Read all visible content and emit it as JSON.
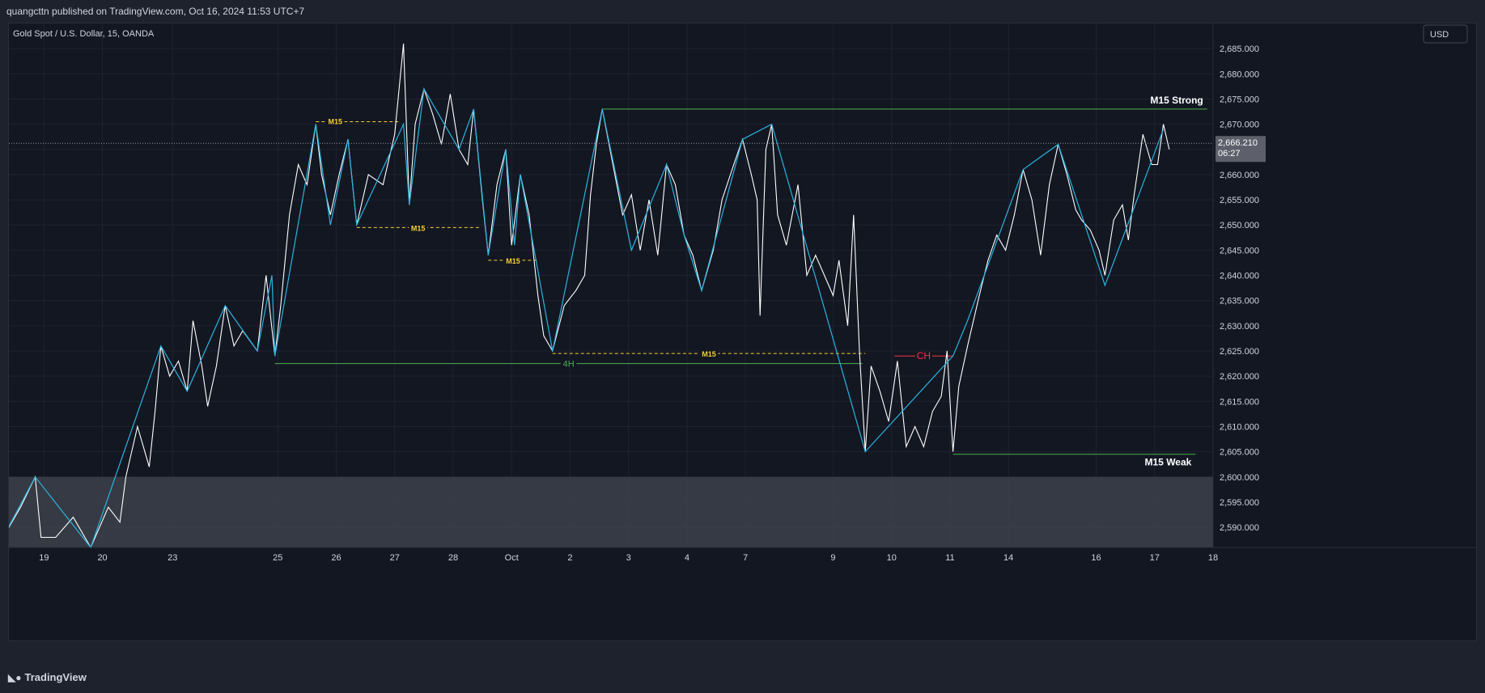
{
  "header": {
    "publisher_line": "quangcttn published on TradingView.com, Oct 16, 2024 11:53 UTC+7"
  },
  "footer": {
    "brand": "TradingView",
    "brand_icon": "tradingview-logo-icon"
  },
  "colors": {
    "background": "#131722",
    "price_line": "#ffffff",
    "zigzag": "#2ab4e0",
    "m15_level": "#f5d033",
    "strong_line": "#4caf50",
    "ch_line": "#f23645",
    "shade": "#40434d",
    "text": "#d1d4dc"
  },
  "chart_data": {
    "type": "line",
    "title": "Gold Spot / U.S. Dollar, 15, OANDA",
    "currency": "USD",
    "current_price": "2,666.210",
    "countdown": "06:27",
    "ylim": [
      2586,
      2690
    ],
    "y_ticks": [
      "2,590.000",
      "2,595.000",
      "2,600.000",
      "2,605.000",
      "2,610.000",
      "2,615.000",
      "2,620.000",
      "2,625.000",
      "2,630.000",
      "2,635.000",
      "2,640.000",
      "2,645.000",
      "2,650.000",
      "2,655.000",
      "2,660.000",
      "2,665.000",
      "2,670.000",
      "2,675.000",
      "2,680.000",
      "2,685.000"
    ],
    "x_ticks": [
      "19",
      "20",
      "23",
      "25",
      "26",
      "27",
      "28",
      "Oct",
      "2",
      "3",
      "4",
      "7",
      "9",
      "10",
      "11",
      "14",
      "16",
      "17",
      "18"
    ],
    "x_tick_index": [
      0.4,
      1.4,
      2.6,
      4.4,
      5.4,
      6.4,
      7.4,
      8.4,
      9.4,
      10.4,
      11.4,
      12.4,
      13.9,
      14.9,
      15.9,
      16.9,
      18.4,
      19.4,
      20.4
    ],
    "xlim": [
      -0.2,
      20.4
    ],
    "price_path": [
      [
        -0.3,
        2588
      ],
      [
        0.0,
        2594
      ],
      [
        0.25,
        2600
      ],
      [
        0.35,
        2588
      ],
      [
        0.6,
        2588
      ],
      [
        0.9,
        2592
      ],
      [
        1.2,
        2586
      ],
      [
        1.5,
        2594
      ],
      [
        1.7,
        2591
      ],
      [
        1.8,
        2600
      ],
      [
        2.0,
        2610
      ],
      [
        2.2,
        2602
      ],
      [
        2.3,
        2613
      ],
      [
        2.4,
        2626
      ],
      [
        2.55,
        2620
      ],
      [
        2.7,
        2623
      ],
      [
        2.85,
        2617
      ],
      [
        2.95,
        2631
      ],
      [
        3.1,
        2622
      ],
      [
        3.2,
        2614
      ],
      [
        3.35,
        2622
      ],
      [
        3.5,
        2634
      ],
      [
        3.65,
        2626
      ],
      [
        3.8,
        2629
      ],
      [
        4.05,
        2625
      ],
      [
        4.2,
        2640
      ],
      [
        4.35,
        2624
      ],
      [
        4.45,
        2634
      ],
      [
        4.6,
        2652
      ],
      [
        4.75,
        2662
      ],
      [
        4.9,
        2658
      ],
      [
        5.05,
        2670
      ],
      [
        5.15,
        2660
      ],
      [
        5.3,
        2652
      ],
      [
        5.45,
        2660
      ],
      [
        5.6,
        2667
      ],
      [
        5.75,
        2650
      ],
      [
        5.95,
        2660
      ],
      [
        6.2,
        2658
      ],
      [
        6.4,
        2668
      ],
      [
        6.55,
        2686
      ],
      [
        6.65,
        2654
      ],
      [
        6.75,
        2670
      ],
      [
        6.9,
        2677
      ],
      [
        7.05,
        2672
      ],
      [
        7.2,
        2666
      ],
      [
        7.35,
        2676
      ],
      [
        7.5,
        2665
      ],
      [
        7.65,
        2662
      ],
      [
        7.75,
        2673
      ],
      [
        7.9,
        2655
      ],
      [
        8.0,
        2644
      ],
      [
        8.15,
        2658
      ],
      [
        8.3,
        2665
      ],
      [
        8.4,
        2646
      ],
      [
        8.55,
        2660
      ],
      [
        8.7,
        2652
      ],
      [
        8.85,
        2636
      ],
      [
        8.95,
        2628
      ],
      [
        9.1,
        2625
      ],
      [
        9.3,
        2634
      ],
      [
        9.5,
        2637
      ],
      [
        9.65,
        2640
      ],
      [
        9.75,
        2656
      ],
      [
        9.85,
        2666
      ],
      [
        9.95,
        2673
      ],
      [
        10.1,
        2664
      ],
      [
        10.3,
        2652
      ],
      [
        10.45,
        2656
      ],
      [
        10.6,
        2645
      ],
      [
        10.75,
        2655
      ],
      [
        10.9,
        2644
      ],
      [
        11.05,
        2662
      ],
      [
        11.2,
        2658
      ],
      [
        11.35,
        2648
      ],
      [
        11.5,
        2644
      ],
      [
        11.65,
        2637
      ],
      [
        11.85,
        2645
      ],
      [
        12.0,
        2655
      ],
      [
        12.2,
        2662
      ],
      [
        12.35,
        2667
      ],
      [
        12.5,
        2660
      ],
      [
        12.6,
        2655
      ],
      [
        12.65,
        2632
      ],
      [
        12.75,
        2665
      ],
      [
        12.85,
        2670
      ],
      [
        12.95,
        2652
      ],
      [
        13.1,
        2646
      ],
      [
        13.3,
        2658
      ],
      [
        13.45,
        2640
      ],
      [
        13.6,
        2644
      ],
      [
        13.75,
        2640
      ],
      [
        13.9,
        2636
      ],
      [
        14.0,
        2643
      ],
      [
        14.15,
        2630
      ],
      [
        14.25,
        2652
      ],
      [
        14.35,
        2625
      ],
      [
        14.45,
        2605
      ],
      [
        14.55,
        2622
      ],
      [
        14.7,
        2617
      ],
      [
        14.85,
        2611
      ],
      [
        15.0,
        2623
      ],
      [
        15.15,
        2606
      ],
      [
        15.3,
        2610
      ],
      [
        15.45,
        2606
      ],
      [
        15.6,
        2613
      ],
      [
        15.75,
        2616
      ],
      [
        15.85,
        2625
      ],
      [
        15.95,
        2605
      ],
      [
        16.05,
        2618
      ],
      [
        16.2,
        2626
      ],
      [
        16.4,
        2636
      ],
      [
        16.55,
        2643
      ],
      [
        16.7,
        2648
      ],
      [
        16.85,
        2645
      ],
      [
        17.0,
        2652
      ],
      [
        17.15,
        2661
      ],
      [
        17.3,
        2655
      ],
      [
        17.45,
        2644
      ],
      [
        17.6,
        2658
      ],
      [
        17.75,
        2666
      ],
      [
        17.9,
        2660
      ],
      [
        18.05,
        2653
      ],
      [
        18.15,
        2651
      ],
      [
        18.3,
        2649
      ],
      [
        18.45,
        2645
      ],
      [
        18.55,
        2640
      ],
      [
        18.7,
        2651
      ],
      [
        18.85,
        2654
      ],
      [
        18.95,
        2647
      ],
      [
        19.05,
        2656
      ],
      [
        19.2,
        2668
      ],
      [
        19.35,
        2662
      ],
      [
        19.45,
        2662
      ],
      [
        19.55,
        2670
      ],
      [
        19.65,
        2665
      ]
    ],
    "zigzag": [
      [
        -0.3,
        2588
      ],
      [
        0.25,
        2600
      ],
      [
        1.2,
        2586
      ],
      [
        2.4,
        2626
      ],
      [
        2.85,
        2617
      ],
      [
        3.5,
        2634
      ],
      [
        4.05,
        2625
      ],
      [
        4.3,
        2640
      ],
      [
        4.35,
        2624
      ],
      [
        5.05,
        2670
      ],
      [
        5.3,
        2650
      ],
      [
        5.6,
        2667
      ],
      [
        5.75,
        2650
      ],
      [
        6.55,
        2670
      ],
      [
        6.65,
        2654
      ],
      [
        6.9,
        2677
      ],
      [
        7.5,
        2665
      ],
      [
        7.75,
        2673
      ],
      [
        8.0,
        2644
      ],
      [
        8.3,
        2665
      ],
      [
        8.45,
        2646
      ],
      [
        8.55,
        2660
      ],
      [
        9.1,
        2625
      ],
      [
        9.95,
        2673
      ],
      [
        10.45,
        2645
      ],
      [
        11.05,
        2662
      ],
      [
        11.35,
        2648
      ],
      [
        11.65,
        2637
      ],
      [
        12.35,
        2667
      ],
      [
        12.85,
        2670
      ],
      [
        14.45,
        2605
      ],
      [
        15.95,
        2624
      ],
      [
        16.2,
        2631
      ],
      [
        17.15,
        2661
      ],
      [
        17.75,
        2666
      ],
      [
        18.55,
        2638
      ],
      [
        19.55,
        2669
      ]
    ],
    "levels": [
      {
        "label": "M15",
        "y": 2670.5,
        "x1": 5.05,
        "x2": 6.5,
        "style": "m15",
        "label_pos": "left"
      },
      {
        "label": "M15",
        "y": 2649.5,
        "x1": 5.75,
        "x2": 7.85,
        "style": "m15",
        "label_pos": "mid"
      },
      {
        "label": "M15",
        "y": 2643,
        "x1": 8.0,
        "x2": 8.85,
        "style": "m15",
        "label_pos": "mid"
      },
      {
        "label": "M15",
        "y": 2624.5,
        "x1": 9.1,
        "x2": 14.45,
        "style": "m15",
        "label_pos": "mid"
      },
      {
        "label": "4H",
        "y": 2622.5,
        "x1": 4.35,
        "x2": 14.4,
        "style": "strong",
        "label_pos": "mid"
      },
      {
        "label": "M15 Strong",
        "y": 2673,
        "x1": 9.95,
        "x2": 20.3,
        "style": "strong",
        "label_pos": "right"
      },
      {
        "label": "M15 Weak",
        "y": 2604.5,
        "x1": 15.95,
        "x2": 20.1,
        "style": "strong",
        "label_pos": "right"
      },
      {
        "label": "CH",
        "y": 2624,
        "x1": 14.95,
        "x2": 15.95,
        "style": "ch",
        "label_pos": "mid"
      }
    ],
    "shade_band": [
      2586,
      2600
    ]
  }
}
